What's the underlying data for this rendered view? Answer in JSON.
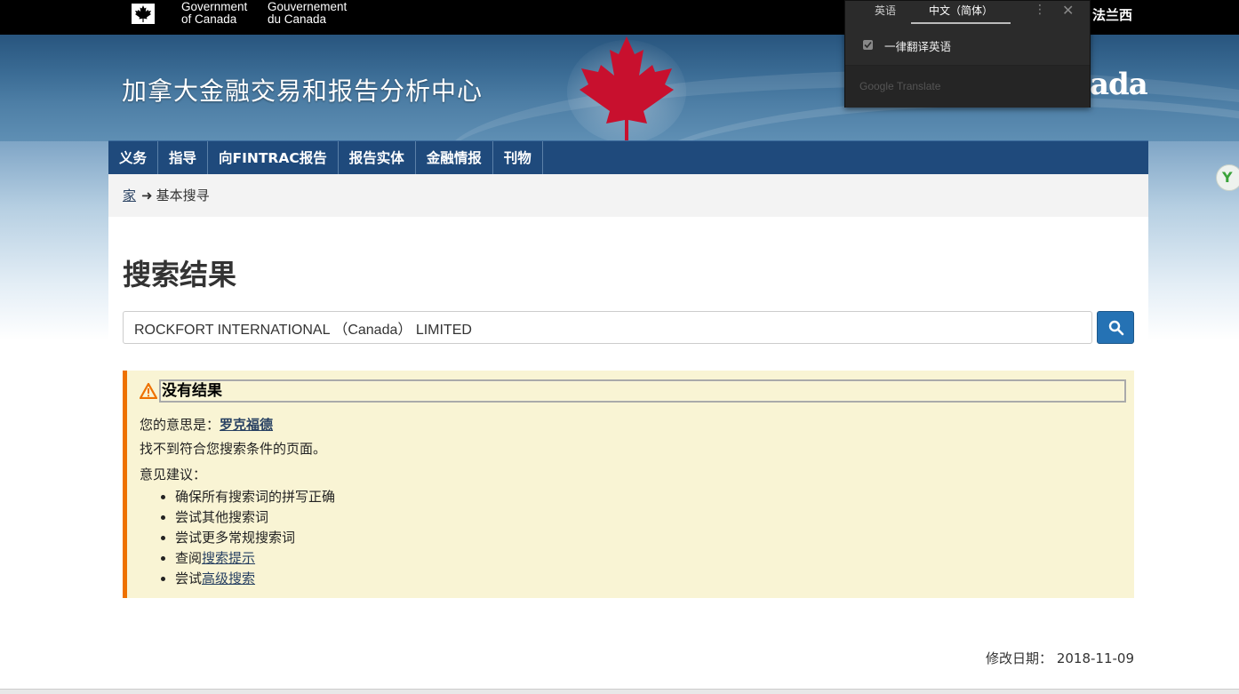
{
  "fip": {
    "en_line1": "Government",
    "en_line2": "of Canada",
    "fr_line1": "Gouvernement",
    "fr_line2": "du Canada",
    "lang_link": "法兰西"
  },
  "banner": {
    "site_title": "加拿大金融交易和报告分析中心",
    "wordmark": "ada"
  },
  "menu": [
    {
      "label": "义务"
    },
    {
      "label": "指导"
    },
    {
      "label": "向FINTRAC报告"
    },
    {
      "label": "报告实体"
    },
    {
      "label": "金融情报"
    },
    {
      "label": "刊物"
    }
  ],
  "breadcrumb": {
    "home": "家",
    "arrow": "➜",
    "current": "基本搜寻"
  },
  "page_title": "搜索结果",
  "search": {
    "value": "ROCKFORT INTERNATIONAL （Canada） LIMITED",
    "button_icon": "search-icon"
  },
  "alert": {
    "title": "没有结果",
    "did_you_mean_label": "您的意思是：",
    "did_you_mean_link": "罗克福德",
    "no_match": "找不到符合您搜索条件的页面。",
    "suggestions_label": "意见建议：",
    "suggestions": {
      "s1": "确保所有搜索词的拼写正确",
      "s2": "尝试其他搜索词",
      "s3": "尝试更多常规搜索词",
      "s4_prefix": "查阅",
      "s4_link": "搜索提示",
      "s5_prefix": "尝试",
      "s5_link": "高级搜索"
    },
    "accent_color": "#ee7100",
    "background_color": "#f9f4d4"
  },
  "modified": {
    "label": "修改日期：",
    "date": "2018-11-09"
  },
  "translate_popup": {
    "tab_english": "英语",
    "tab_chinese": "中文（简体）",
    "more_icon": "⋮",
    "close_icon": "✕",
    "always_translate": "一律翻译英语",
    "brand": "Google Translate"
  },
  "colors": {
    "menu_bg": "#1f4a7c",
    "link": "#284162",
    "search_button": "#2572b4"
  }
}
